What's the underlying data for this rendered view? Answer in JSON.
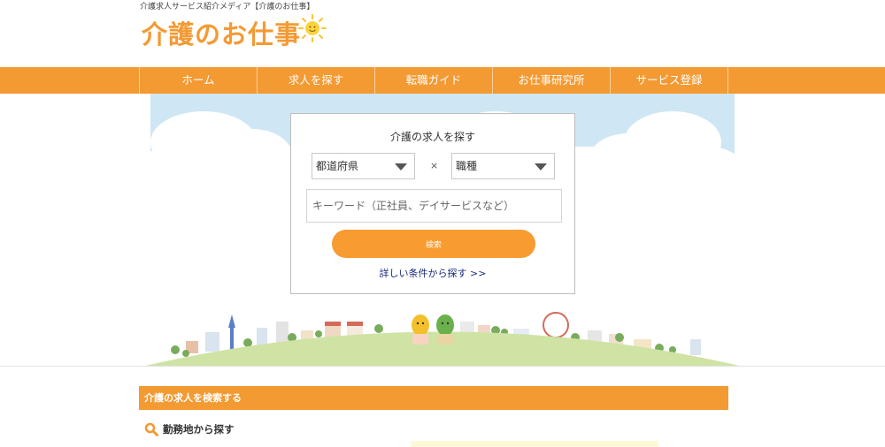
{
  "header": {
    "tagline": "介護求人サービス紹介メディア【介護のお仕事】",
    "logo_text": "介護のお仕事"
  },
  "nav": {
    "items": [
      "ホーム",
      "求人を探す",
      "転職ガイド",
      "お仕事研究所",
      "サービス登録"
    ]
  },
  "search": {
    "title": "介護の求人を探す",
    "prefecture_select": "都道府県",
    "times_symbol": "×",
    "job_select": "職種",
    "keyword_placeholder": "キーワード（正社員、デイサービスなど）",
    "button_label": "検索",
    "advanced_link": "詳しい条件から探す >>"
  },
  "section": {
    "title": "介護の求人を検索する",
    "sub_heading": "勤務地から探す"
  },
  "colors": {
    "accent": "#f39a33",
    "sky": "#cde6f3",
    "grass": "#cfe3a5",
    "link": "#1b2a7a"
  }
}
